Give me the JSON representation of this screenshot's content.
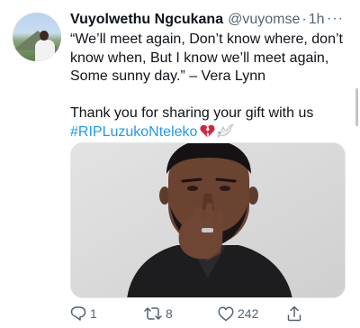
{
  "tweet": {
    "author_name": "Vuyolwethu Ngcukana",
    "handle": "@vuyomse",
    "separator": "·",
    "time": "1h",
    "more_label": "···",
    "text_lines": [
      "“We’ll meet again, Don’t know where, don’t",
      "know when, But I know we’ll meet again,",
      "Some sunny day.” – Vera Lynn"
    ],
    "text_line_2": "Thank you for sharing your gift with us",
    "hashtag": "#RIPLuzukoNteleko",
    "emoji": [
      "broken-heart-icon",
      "dove-icon"
    ]
  },
  "actions": {
    "reply_count": "1",
    "retweet_count": "8",
    "like_count": "242"
  },
  "colors": {
    "link": "#1d9bf0",
    "muted": "#536471",
    "text": "#0f1419",
    "heart": "#d8233a"
  }
}
